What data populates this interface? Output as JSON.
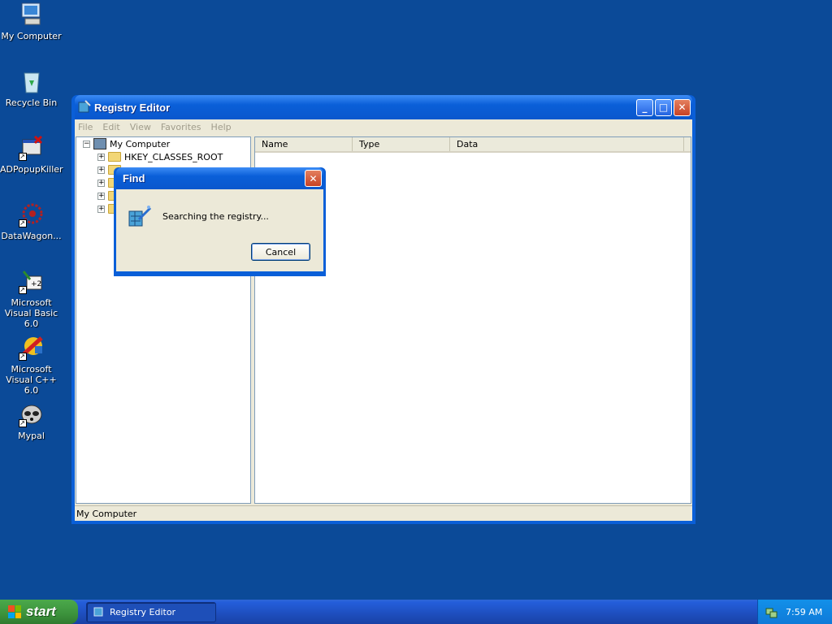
{
  "desktop": {
    "icons": [
      {
        "label": "My Computer",
        "icon": "my-computer-icon"
      },
      {
        "label": "Recycle Bin",
        "icon": "recycle-bin-icon"
      },
      {
        "label": "ADPopupKiller",
        "icon": "adpopupkiller-icon"
      },
      {
        "label": "DataWagon...",
        "icon": "datawagon-icon"
      },
      {
        "label": "Microsoft Visual Basic 6.0",
        "icon": "visual-basic-icon"
      },
      {
        "label": "Microsoft Visual C++ 6.0",
        "icon": "visual-cpp-icon"
      },
      {
        "label": "Mypal",
        "icon": "mypal-icon"
      }
    ]
  },
  "registry_window": {
    "title": "Registry Editor",
    "menu": [
      "File",
      "Edit",
      "View",
      "Favorites",
      "Help"
    ],
    "tree": {
      "root": "My Computer",
      "items": [
        "HKEY_CLASSES_ROOT"
      ]
    },
    "list_columns": [
      "Name",
      "Type",
      "Data"
    ],
    "status": "My Computer"
  },
  "find_dialog": {
    "title": "Find",
    "message": "Searching the registry...",
    "cancel_label": "Cancel"
  },
  "taskbar": {
    "start_label": "start",
    "task_button_label": "Registry Editor",
    "clock": "7:59 AM"
  },
  "colors": {
    "desktop": "#0b4a98",
    "title_blue": "#0a5fd8",
    "window_face": "#ece9d8",
    "start_green": "#3c923c"
  }
}
